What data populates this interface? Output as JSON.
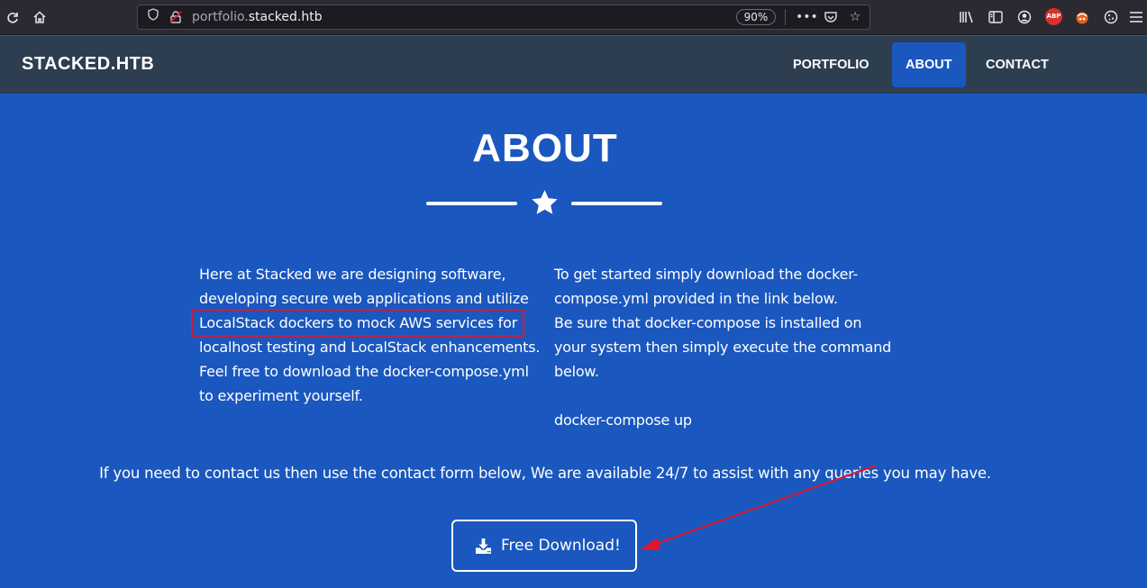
{
  "browser": {
    "url_prefix": "portfolio.",
    "url_host": "stacked.htb",
    "zoom": "90%",
    "toolbar_icons": [
      "reload-icon",
      "home-icon",
      "shield-icon",
      "insecure-lock-icon",
      "more-icon",
      "pocket-icon",
      "bookmark-star-icon",
      "library-icon",
      "sidebar-icon",
      "account-icon",
      "adblock-icon",
      "extension-icon",
      "cookie-icon",
      "menu-icon"
    ],
    "adblock_label": "ABP"
  },
  "navbar": {
    "brand": "STACKED.HTB",
    "links": [
      {
        "label": "PORTFOLIO",
        "active": false
      },
      {
        "label": "ABOUT",
        "active": true
      },
      {
        "label": "CONTACT",
        "active": false
      }
    ]
  },
  "about": {
    "title": "ABOUT",
    "left_lines": [
      "Here at Stacked we are designing software,",
      "developing secure web applications and utilize",
      "LocalStack dockers to mock AWS services for",
      "localhost testing and LocalStack enhancements.",
      "Feel free to download the docker-compose.yml",
      "to experiment yourself."
    ],
    "right_lines": [
      "To get started simply download the docker-",
      "compose.yml provided in the link below.",
      "Be sure that docker-compose is installed on",
      "your system then simply execute the command",
      "below.",
      "",
      "docker-compose up"
    ],
    "contact_note": "If you need to contact us then use the contact form below, We are available 24/7 to assist with any queries you may have.",
    "download_label": "Free Download!"
  },
  "colors": {
    "section_bg": "#1a57bf",
    "navbar_bg": "#2c3e50",
    "annotation_red": "#e0162b"
  }
}
